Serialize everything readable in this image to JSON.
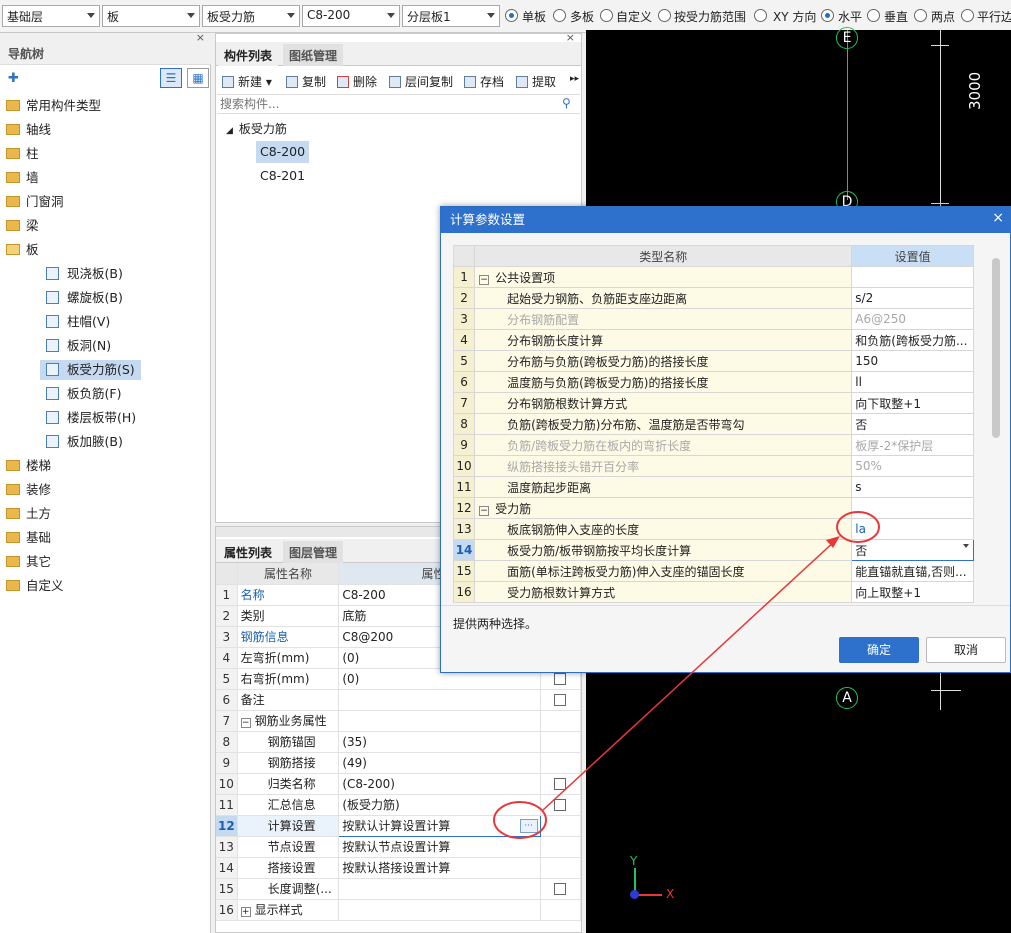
{
  "toolbar": {
    "floor": "基础层",
    "element_type": "板",
    "component_type": "板受力筋",
    "component_name": "C8-200",
    "layer": "分层板1",
    "radio_options": [
      {
        "label": "单板",
        "checked": true
      },
      {
        "label": "多板",
        "checked": false
      },
      {
        "label": "自定义",
        "checked": false
      },
      {
        "label": "按受力筋范围",
        "checked": false
      },
      {
        "label": "XY 方向",
        "checked": false
      },
      {
        "label": "水平",
        "checked": true
      },
      {
        "label": "垂直",
        "checked": false
      },
      {
        "label": "两点",
        "checked": false
      },
      {
        "label": "平行边",
        "checked": false
      }
    ]
  },
  "nav": {
    "title": "导航树",
    "items": [
      {
        "label": "常用构件类型"
      },
      {
        "label": "轴线"
      },
      {
        "label": "柱"
      },
      {
        "label": "墙"
      },
      {
        "label": "门窗洞"
      },
      {
        "label": "梁"
      },
      {
        "label": "板"
      },
      {
        "label": "现浇板(B)"
      },
      {
        "label": "螺旋板(B)"
      },
      {
        "label": "柱帽(V)"
      },
      {
        "label": "板洞(N)"
      },
      {
        "label": "板受力筋(S)"
      },
      {
        "label": "板负筋(F)"
      },
      {
        "label": "楼层板带(H)"
      },
      {
        "label": "板加腋(B)"
      },
      {
        "label": "楼梯"
      },
      {
        "label": "装修"
      },
      {
        "label": "土方"
      },
      {
        "label": "基础"
      },
      {
        "label": "其它"
      },
      {
        "label": "自定义"
      }
    ]
  },
  "complist": {
    "tab1": "构件列表",
    "tab2": "图纸管理",
    "btn_new": "新建",
    "btn_copy": "复制",
    "btn_delete": "删除",
    "btn_floorcopy": "层间复制",
    "btn_save": "存档",
    "btn_extract": "提取",
    "search_placeholder": "搜索构件...",
    "group": "板受力筋",
    "items": [
      "C8-200",
      "C8-201"
    ]
  },
  "props": {
    "tab1": "属性列表",
    "tab2": "图层管理",
    "col_name": "属性名称",
    "col_value": "属性值",
    "col_extra": "附加",
    "rows": [
      {
        "num": "1",
        "name": "名称",
        "value": "C8-200"
      },
      {
        "num": "2",
        "name": "类别",
        "value": "底筋"
      },
      {
        "num": "3",
        "name": "钢筋信息",
        "value": "C8@200"
      },
      {
        "num": "4",
        "name": "左弯折(mm)",
        "value": "(0)"
      },
      {
        "num": "5",
        "name": "右弯折(mm)",
        "value": "(0)"
      },
      {
        "num": "6",
        "name": "备注",
        "value": ""
      },
      {
        "num": "7",
        "name": "钢筋业务属性",
        "value": ""
      },
      {
        "num": "8",
        "name": "钢筋锚固",
        "value": "(35)"
      },
      {
        "num": "9",
        "name": "钢筋搭接",
        "value": "(49)"
      },
      {
        "num": "10",
        "name": "归类名称",
        "value": "(C8-200)"
      },
      {
        "num": "11",
        "name": "汇总信息",
        "value": "(板受力筋)"
      },
      {
        "num": "12",
        "name": "计算设置",
        "value": "按默认计算设置计算"
      },
      {
        "num": "13",
        "name": "节点设置",
        "value": "按默认节点设置计算"
      },
      {
        "num": "14",
        "name": "搭接设置",
        "value": "按默认搭接设置计算"
      },
      {
        "num": "15",
        "name": "长度调整(...",
        "value": ""
      },
      {
        "num": "16",
        "name": "显示样式",
        "value": ""
      }
    ],
    "ellipsis": "···"
  },
  "cad": {
    "axis_labels": [
      "E",
      "D",
      "A"
    ],
    "dimension": "3000",
    "ucs_x": "X",
    "ucs_y": "Y"
  },
  "dialog": {
    "title": "计算参数设置",
    "col_name": "类型名称",
    "col_value": "设置值",
    "rows": [
      {
        "num": "1",
        "name": "公共设置项",
        "value": "",
        "type": "group"
      },
      {
        "num": "2",
        "name": "起始受力钢筋、负筋距支座边距离",
        "value": "s/2",
        "type": "normal"
      },
      {
        "num": "3",
        "name": "分布钢筋配置",
        "value": "A6@250",
        "type": "grey"
      },
      {
        "num": "4",
        "name": "分布钢筋长度计算",
        "value": "和负筋(跨板受力筋...",
        "type": "normal"
      },
      {
        "num": "5",
        "name": "分布筋与负筋(跨板受力筋)的搭接长度",
        "value": "150",
        "type": "normal"
      },
      {
        "num": "6",
        "name": "温度筋与负筋(跨板受力筋)的搭接长度",
        "value": "ll",
        "type": "normal"
      },
      {
        "num": "7",
        "name": "分布钢筋根数计算方式",
        "value": "向下取整+1",
        "type": "normal"
      },
      {
        "num": "8",
        "name": "负筋(跨板受力筋)分布筋、温度筋是否带弯勾",
        "value": "否",
        "type": "normal"
      },
      {
        "num": "9",
        "name": "负筋/跨板受力筋在板内的弯折长度",
        "value": "板厚-2*保护层",
        "type": "grey"
      },
      {
        "num": "10",
        "name": "纵筋搭接接头错开百分率",
        "value": "50%",
        "type": "grey"
      },
      {
        "num": "11",
        "name": "温度筋起步距离",
        "value": "s",
        "type": "normal"
      },
      {
        "num": "12",
        "name": "受力筋",
        "value": "",
        "type": "group"
      },
      {
        "num": "13",
        "name": "板底钢筋伸入支座的长度",
        "value": "la",
        "type": "normal"
      },
      {
        "num": "14",
        "name": "板受力筋/板带钢筋按平均长度计算",
        "value": "否",
        "type": "selected"
      },
      {
        "num": "15",
        "name": "面筋(单标注跨板受力筋)伸入支座的锚固长度",
        "value": "能直锚就直锚,否则...",
        "type": "normal"
      },
      {
        "num": "16",
        "name": "受力筋根数计算方式",
        "value": "向上取整+1",
        "type": "normal"
      }
    ],
    "hint": "提供两种选择。",
    "ok": "确定",
    "cancel": "取消",
    "close": "×"
  },
  "colors": {
    "accent": "#2e71cc",
    "annotation": "#e8363a",
    "cad_bg": "#000000",
    "axis_green": "#22c45a"
  }
}
